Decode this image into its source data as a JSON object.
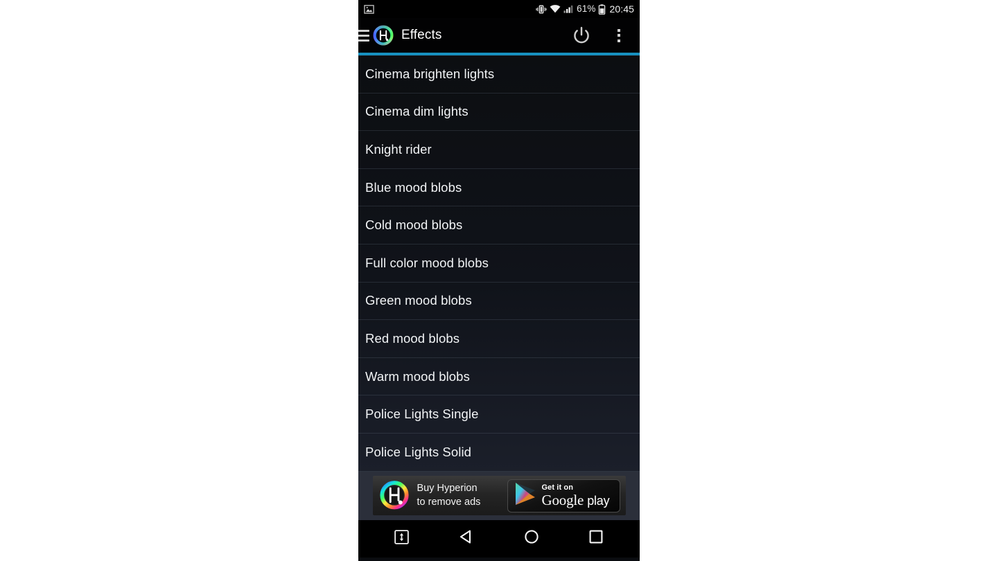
{
  "status_bar": {
    "notification_icon": "image-notification-icon",
    "icons": [
      "vibrate-icon",
      "wifi-icon",
      "cellular-signal-icon"
    ],
    "battery_percent": "61%",
    "battery_icon": "battery-icon",
    "time": "20:45"
  },
  "app_bar": {
    "menu_icon": "hamburger-menu-icon",
    "logo": "hyperion-logo-icon",
    "title": "Effects",
    "power_icon": "power-icon",
    "overflow_icon": "overflow-menu-icon",
    "accent_color": "#1791c0"
  },
  "effects": [
    {
      "label": "Cinema brighten lights"
    },
    {
      "label": "Cinema dim lights"
    },
    {
      "label": "Knight rider"
    },
    {
      "label": "Blue mood blobs"
    },
    {
      "label": "Cold mood blobs"
    },
    {
      "label": "Full color mood blobs"
    },
    {
      "label": "Green mood blobs"
    },
    {
      "label": "Red mood blobs"
    },
    {
      "label": "Warm mood blobs"
    },
    {
      "label": "Police Lights Single"
    },
    {
      "label": "Police Lights Solid"
    }
  ],
  "ad": {
    "logo": "hyperion-logo-icon",
    "line1": "Buy Hyperion",
    "line2": "to remove ads",
    "badge": {
      "icon": "google-play-triangle-icon",
      "top_text": "Get it on",
      "brand": "Google",
      "product": "play"
    }
  },
  "nav_bar": {
    "buttons": [
      {
        "name": "ime-switcher-button",
        "icon": "keyboard-switch-icon"
      },
      {
        "name": "back-button",
        "icon": "back-triangle-icon"
      },
      {
        "name": "home-button",
        "icon": "home-circle-icon"
      },
      {
        "name": "recents-button",
        "icon": "recents-square-icon"
      }
    ]
  }
}
